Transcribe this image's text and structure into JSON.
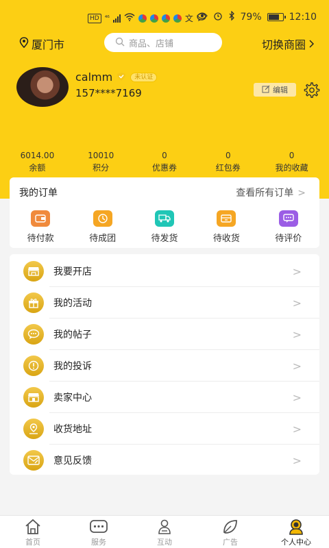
{
  "status_bar": {
    "battery": "79%",
    "time": "12:10",
    "hd": "HD",
    "signal": "⁴⁶"
  },
  "header": {
    "location": "厦门市",
    "search_placeholder": "商品、店铺",
    "switch_label": "切换商圈"
  },
  "profile": {
    "username": "calmm",
    "badge": "未认证",
    "phone": "157****7169",
    "edit_label": "编辑"
  },
  "stats": [
    {
      "value": "6014.00",
      "label": "余额"
    },
    {
      "value": "10010",
      "label": "积分"
    },
    {
      "value": "0",
      "label": "优惠券"
    },
    {
      "value": "0",
      "label": "红包券"
    },
    {
      "value": "0",
      "label": "我的收藏"
    }
  ],
  "orders": {
    "title": "我的订单",
    "view_all": "查看所有订单",
    "items": [
      {
        "label": "待付款",
        "color": "#f08a3c",
        "icon": "wallet-icon"
      },
      {
        "label": "待成团",
        "color": "#f5a623",
        "icon": "clock-icon"
      },
      {
        "label": "待发货",
        "color": "#20c6b6",
        "icon": "truck-icon"
      },
      {
        "label": "待收货",
        "color": "#f5a623",
        "icon": "box-icon"
      },
      {
        "label": "待评价",
        "color": "#9b5de5",
        "icon": "comment-icon"
      }
    ]
  },
  "menu": [
    {
      "label": "我要开店",
      "icon": "shop-icon"
    },
    {
      "label": "我的活动",
      "icon": "gift-icon"
    },
    {
      "label": "我的帖子",
      "icon": "chat-icon"
    },
    {
      "label": "我的投诉",
      "icon": "alert-icon"
    },
    {
      "label": "卖家中心",
      "icon": "store-icon"
    },
    {
      "label": "收货地址",
      "icon": "location-icon"
    },
    {
      "label": "意见反馈",
      "icon": "feedback-icon"
    }
  ],
  "bottom_nav": [
    {
      "label": "首页",
      "icon": "home-icon"
    },
    {
      "label": "服务",
      "icon": "service-icon"
    },
    {
      "label": "互动",
      "icon": "interact-icon"
    },
    {
      "label": "广告",
      "icon": "ad-icon"
    },
    {
      "label": "个人中心",
      "icon": "profile-icon",
      "active": true
    }
  ],
  "colors": {
    "brand_yellow": "#fccf14",
    "menu_icon_gold": "#e0b030"
  }
}
